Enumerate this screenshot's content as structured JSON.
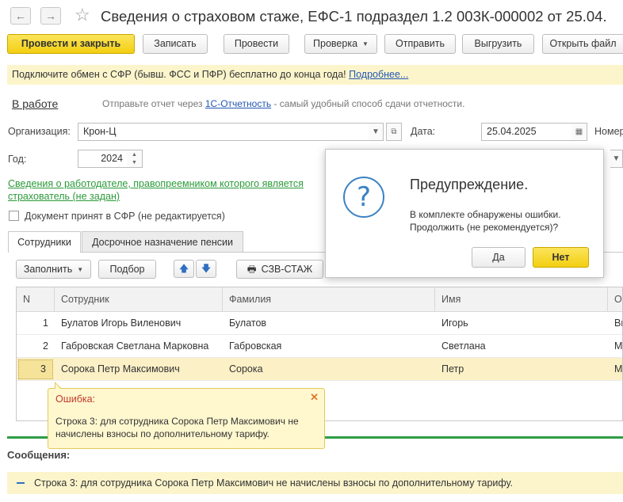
{
  "window": {
    "title": "Сведения о страховом стаже, ЕФС-1 подраздел 1.2 003К-000002 от 25.04.",
    "back_glyph": "←",
    "forward_glyph": "→",
    "star_glyph": "☆"
  },
  "toolbar": {
    "post_close": "Провести и закрыть",
    "save": "Записать",
    "post": "Провести",
    "check": "Проверка",
    "send": "Отправить",
    "export": "Выгрузить",
    "open_file": "Открыть файл"
  },
  "banner": {
    "text": "Подключите обмен с СФР (бывш. ФСС и ПФР) бесплатно до конца года!",
    "link": "Подробнее..."
  },
  "status": {
    "value": "В работе",
    "hint_prefix": "Отправьте отчет через",
    "hint_link": "1С-Отчетность",
    "hint_suffix": "- самый удобный способ сдачи отчетности."
  },
  "form": {
    "org_label": "Организация:",
    "org_value": "Крон-Ц",
    "date_label": "Дата:",
    "date_value": "25.04.2025",
    "number_label": "Номер",
    "year_label": "Год:",
    "year_value": "2024",
    "employer_link_line1": "Сведения о работодателе, правопреемником которого является",
    "employer_link_line2": "страхователь (не задан)",
    "accepted_label": "Документ принят в СФР (не редактируется)"
  },
  "tabs": [
    {
      "label": "Сотрудники"
    },
    {
      "label": "Досрочное назначение пенсии"
    }
  ],
  "table_toolbar": {
    "fill": "Заполнить",
    "select": "Подбор",
    "up_glyph": "🡅",
    "down_glyph": "🡇",
    "print_glyph": "🖶",
    "szv": "СЗВ-СТАЖ"
  },
  "table": {
    "headers": [
      "N",
      "Сотрудник",
      "Фамилия",
      "Имя",
      "От"
    ],
    "rows": [
      {
        "n": "1",
        "employee": "Булатов Игорь Виленович",
        "last": "Булатов",
        "first": "Игорь",
        "patr": "Ви"
      },
      {
        "n": "2",
        "employee": "Габровская Светлана Марковна",
        "last": "Габровская",
        "first": "Светлана",
        "patr": "Ма"
      },
      {
        "n": "3",
        "employee": "Сорока Петр Максимович",
        "last": "Сорока",
        "first": "Петр",
        "patr": "Ма"
      }
    ]
  },
  "error_tip": {
    "title": "Ошибка:",
    "close_glyph": "✕",
    "text": "Строка 3: для сотрудника Сорока Петр Максимович не начислены взносы по дополнительному тарифу."
  },
  "messages": {
    "title": "Сообщения:",
    "line": "Строка 3: для сотрудника Сорока Петр Максимович не начислены взносы по дополнительному тарифу."
  },
  "dialog": {
    "icon_glyph": "?",
    "title": "Предупреждение.",
    "line1": "В комплекте обнаружены ошибки.",
    "line2": "Продолжить (не рекомендуется)?",
    "yes": "Да",
    "no": "Нет"
  },
  "colors": {
    "primary_yellow": "#f3cf12",
    "link_blue": "#2356b3",
    "green": "#2e9d45",
    "error_red": "#c0392b",
    "dialog_icon": "#3b82c4"
  }
}
